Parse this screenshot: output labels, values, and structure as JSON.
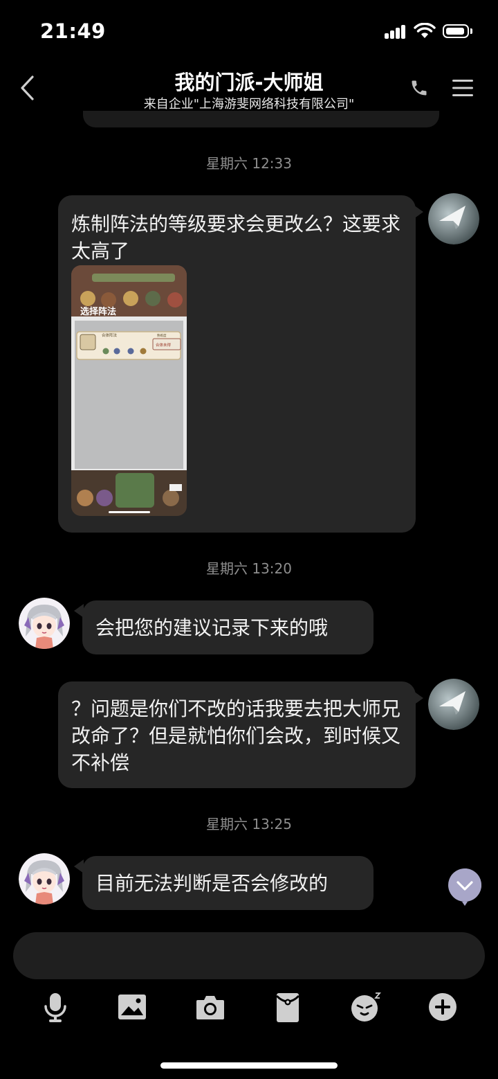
{
  "status_bar": {
    "time": "21:49"
  },
  "header": {
    "title": "我的门派-大师姐",
    "subtitle": "来自企业\"上海游斐网络科技有限公司\""
  },
  "messages": [
    {
      "type": "timestamp",
      "text": "星期六 12:33"
    },
    {
      "type": "outgoing",
      "text": "炼制阵法的等级要求会更改么？这要求太高了",
      "attachment": "image"
    },
    {
      "type": "timestamp",
      "text": "星期六 13:20"
    },
    {
      "type": "incoming",
      "text": "会把您的建议记录下来的哦"
    },
    {
      "type": "outgoing",
      "text": "？问题是你们不改的话我要去把大师兄改命了？但是就怕你们会改，到时候又不补偿"
    },
    {
      "type": "timestamp",
      "text": "星期六 13:25"
    },
    {
      "type": "incoming",
      "text": "目前无法判断是否会修改的"
    }
  ],
  "thumb": {
    "title_text": "选择阵法",
    "card_label": "合体阵法",
    "card_skill": "熟练度",
    "card_stamp": "合体未得"
  },
  "input": {
    "placeholder": ""
  },
  "toolbar": {
    "icons": [
      "microphone-icon",
      "image-icon",
      "camera-icon",
      "red-packet-icon",
      "emoji-icon",
      "plus-icon"
    ]
  },
  "colors": {
    "background": "#000000",
    "bubble": "#262626",
    "timestamp": "#8e8e8e",
    "accent_scroll_button": "#a8a6c8"
  }
}
